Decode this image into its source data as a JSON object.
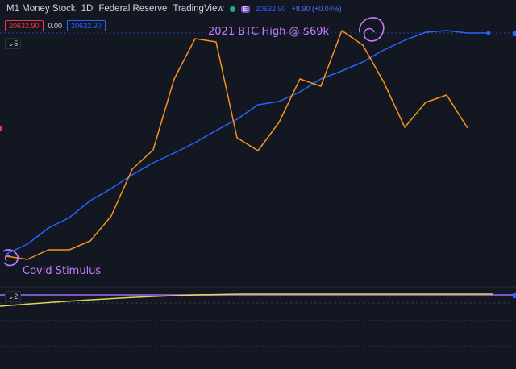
{
  "header": {
    "symbol": "M1 Money Stock",
    "interval": "1D",
    "source": "Federal Reserve",
    "provider": "TradingView",
    "badge": "E",
    "price": "20632.90",
    "change": "+8.90 (+0.04%)"
  },
  "values_row": {
    "red_box": "20632.90",
    "plain": "0.00",
    "blue_box": "20632.90"
  },
  "pane_toggles": {
    "main": "5",
    "lower": "2"
  },
  "annotations": {
    "btc_high": "2021 BTC High @ $69k",
    "covid": "Covid Stimulus"
  },
  "colors": {
    "background": "#131722",
    "m1_line": "#2962ff",
    "btc_line": "#f7931a",
    "lower_line": "#e0d45a",
    "annotation": "#c77dff"
  },
  "chart_data": {
    "type": "line",
    "x": [
      1,
      2,
      3,
      4,
      5,
      6,
      7,
      8,
      9,
      10,
      11,
      12,
      13,
      14,
      15,
      16,
      17,
      18,
      19,
      20,
      21,
      22,
      23,
      24
    ],
    "series": [
      {
        "values": [
          315,
          303,
          283,
          270,
          249,
          234,
          217,
          202,
          190,
          177,
          162,
          148,
          130,
          126,
          114,
          98,
          88,
          77,
          62,
          50,
          40,
          38,
          41,
          41
        ]
      },
      {
        "values": [
          318,
          322,
          310,
          310,
          299,
          268,
          210,
          186,
          98,
          48,
          52,
          171,
          187,
          152,
          98,
          107,
          38,
          56,
          102,
          158,
          127,
          118,
          159
        ]
      }
    ],
    "ylim": [
      0,
      458
    ]
  }
}
